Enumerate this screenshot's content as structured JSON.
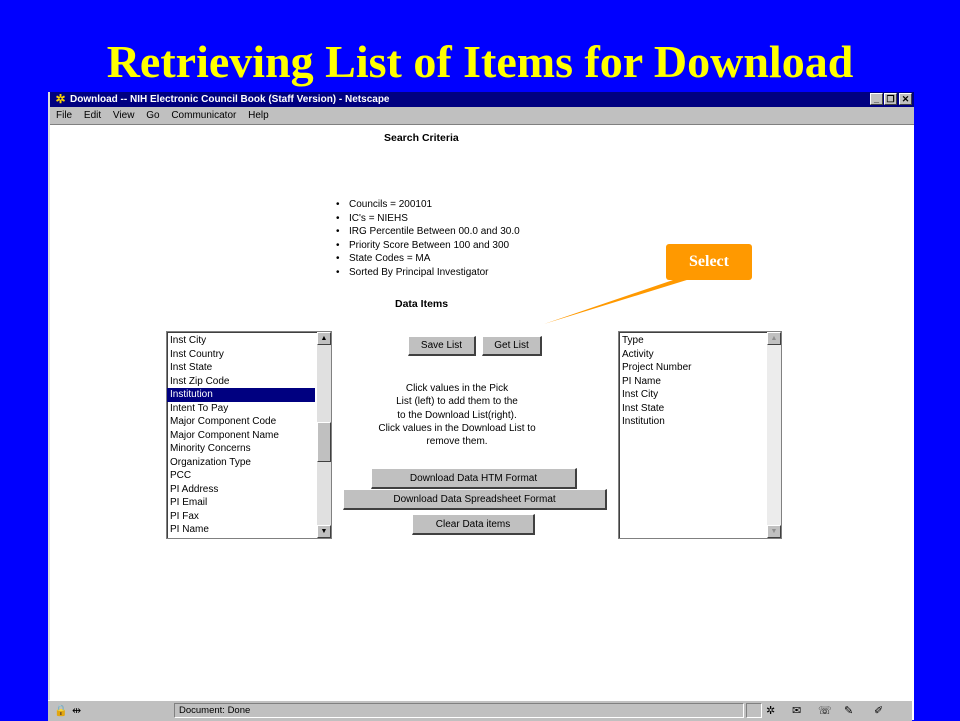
{
  "slide": {
    "title": "Retrieving List of Items for Download"
  },
  "window": {
    "title": "Download -- NIH Electronic Council Book (Staff Version) - Netscape",
    "controls": {
      "minimize": "_",
      "restore": "❐",
      "close": "✕"
    }
  },
  "menu": [
    "File",
    "Edit",
    "View",
    "Go",
    "Communicator",
    "Help"
  ],
  "search_criteria": {
    "heading": "Search Criteria",
    "items": [
      "Councils = 200101",
      "IC's = NIEHS",
      "IRG Percentile Between 00.0 and 30.0",
      "Priority Score Between 100 and 300",
      "State Codes = MA",
      "Sorted By Principal Investigator"
    ]
  },
  "data_items": {
    "heading": "Data Items"
  },
  "pick_list": {
    "items": [
      "Inst City",
      "Inst Country",
      "Inst State",
      "Inst Zip Code",
      "Institution",
      "Intent To Pay",
      "Major Component Code",
      "Major Component Name",
      "Minority Concerns",
      "Organization Type",
      "PCC",
      "PI Address",
      "PI Email",
      "PI Fax",
      "PI Name"
    ],
    "selected": "Institution"
  },
  "download_list": {
    "items": [
      "Type",
      "Activity",
      "Project Number",
      "PI Name",
      "Inst City",
      "Inst State",
      "Institution"
    ]
  },
  "buttons": {
    "save_list": "Save List",
    "get_list": "Get List",
    "download_htm": "Download Data HTM Format",
    "download_spreadsheet": "Download Data Spreadsheet Format",
    "clear": "Clear Data items"
  },
  "instructions": [
    "Click values in the Pick",
    "List (left) to add them to the",
    "to the Download List(right).",
    "Click values in the Download List to",
    "remove them."
  ],
  "callout": {
    "label": "Select",
    "color": "#ff9900"
  },
  "status": {
    "text": "Document: Done"
  },
  "icons": {
    "app": "netscape-icon",
    "scroll_up": "scroll-up-arrow-icon",
    "scroll_down": "scroll-down-arrow-icon",
    "status_lock": "lock-icon",
    "status_network": "network-icon",
    "component_bar": [
      "navigator-icon",
      "mail-icon",
      "discussion-icon",
      "composer-icon",
      "dial-icon"
    ]
  },
  "colors": {
    "slide_bg": "#0000ff",
    "slide_title": "#ffff00",
    "titlebar": "#000080",
    "selection": "#000080"
  }
}
